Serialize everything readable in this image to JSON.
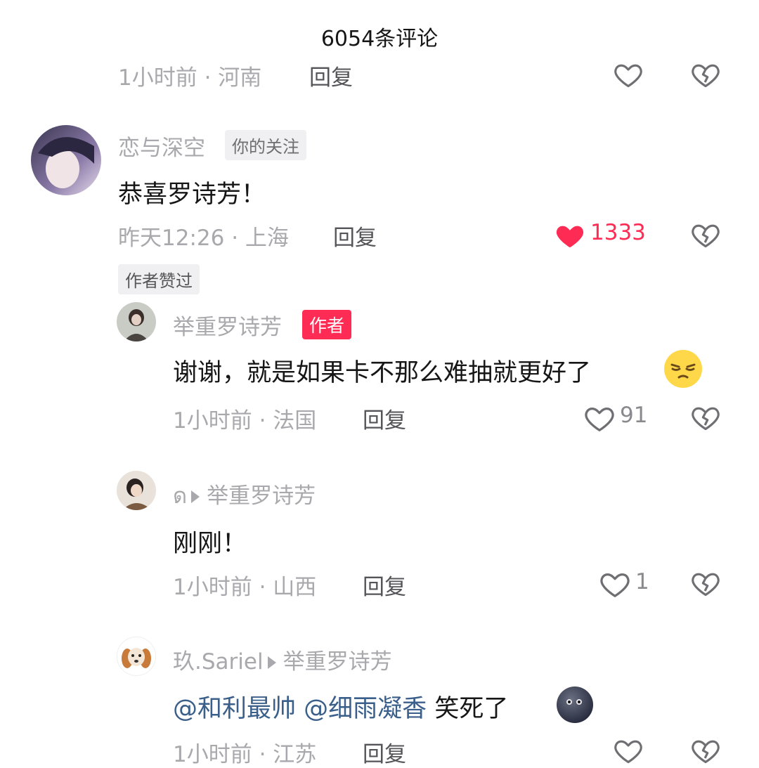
{
  "header": {
    "title": "6054条评论"
  },
  "comments": [
    {
      "time_loc": "1小时前 · 河南",
      "reply": "回复"
    },
    {
      "username": "恋与深空",
      "badge": "你的关注",
      "text": "恭喜罗诗芳！",
      "time_loc": "昨天12:26 · 上海",
      "reply": "回复",
      "likes": "1333",
      "liked": true,
      "author_liked_badge": "作者赞过"
    },
    {
      "username": "举重罗诗芳",
      "badge": "作者",
      "text": "谢谢，就是如果卡不那么难抽就更好了",
      "time_loc": "1小时前 · 法国",
      "reply": "回复",
      "likes": "91"
    },
    {
      "username": "ด",
      "reply_to": "举重罗诗芳",
      "text": "刚刚！",
      "time_loc": "1小时前 · 山西",
      "reply": "回复",
      "likes": "1"
    },
    {
      "username": "玖.Sariel",
      "reply_to": "举重罗诗芳",
      "mention1": "@和利最帅",
      "mention2": "@细雨凝香",
      "text": "笑死了",
      "time_loc": "1小时前 · 江苏",
      "reply": "回复"
    }
  ],
  "colors": {
    "accent": "#fe2c55",
    "mention": "#3a5f8a",
    "meta": "#a9a9ad"
  }
}
